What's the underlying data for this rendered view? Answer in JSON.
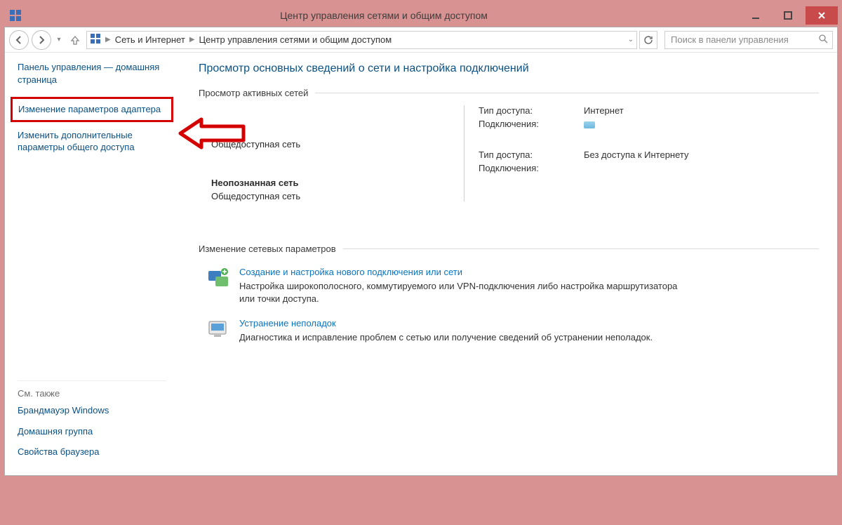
{
  "titlebar": {
    "title": "Центр управления сетями и общим доступом"
  },
  "breadcrumb": {
    "part1": "Сеть и Интернет",
    "part2": "Центр управления сетями и общим доступом"
  },
  "search": {
    "placeholder": "Поиск в панели управления"
  },
  "sidebar": {
    "home": "Панель управления — домашняя страница",
    "adapter": "Изменение параметров адаптера",
    "sharing": "Изменить дополнительные параметры общего доступа",
    "see_also_label": "См. также",
    "firewall": "Брандмауэр Windows",
    "homegroup": "Домашняя группа",
    "browser_props": "Свойства браузера"
  },
  "main": {
    "heading": "Просмотр основных сведений о сети и настройка подключений",
    "active_label": "Просмотр активных сетей",
    "net1": {
      "name": "",
      "type": "Общедоступная сеть",
      "access_label": "Тип доступа:",
      "access_value": "Интернет",
      "conn_label": "Подключения:"
    },
    "net2": {
      "name": "Неопознанная сеть",
      "type": "Общедоступная сеть",
      "access_label": "Тип доступа:",
      "access_value": "Без доступа к Интернету",
      "conn_label": "Подключения:"
    },
    "change_label": "Изменение сетевых параметров",
    "action1": {
      "title": "Создание и настройка нового подключения или сети",
      "desc": "Настройка широкополосного, коммутируемого или VPN-подключения либо настройка маршрутизатора или точки доступа."
    },
    "action2": {
      "title": "Устранение неполадок",
      "desc": "Диагностика и исправление проблем с сетью или получение сведений об устранении неполадок."
    }
  }
}
